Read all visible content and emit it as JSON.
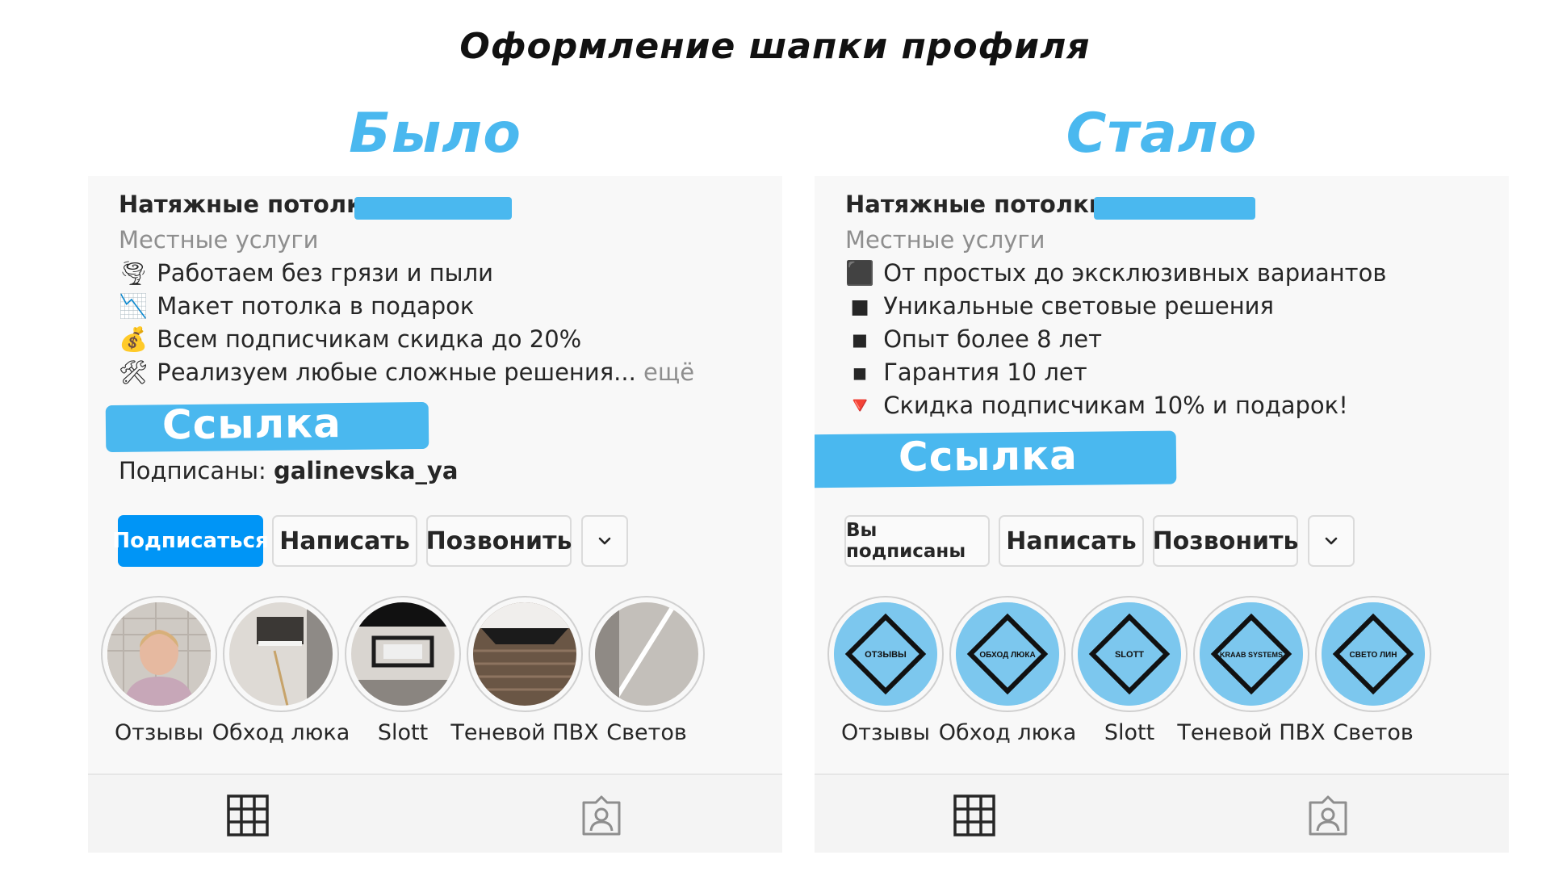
{
  "page": {
    "title": "Оформление шапки профиля"
  },
  "before": {
    "heading": "Было",
    "profile_name": "Натяжные потолки",
    "category": "Местные услуги",
    "bio_lines": [
      {
        "icon": "tornado-icon",
        "glyph": "🌪",
        "text": "Работаем без грязи и пыли"
      },
      {
        "icon": "chart-down-icon",
        "glyph": "📉",
        "text": "Макет потолка в подарок"
      },
      {
        "icon": "money-bag-icon",
        "glyph": "💰",
        "text": "Всем подписчикам скидка до 20%"
      },
      {
        "icon": "tools-icon",
        "glyph": "🛠",
        "text": "Реализуем любые сложные решения..."
      }
    ],
    "more_label": "ещё",
    "link_label": "Ссылка",
    "followed_prefix": "Подписаны:",
    "followed_user": "galinevska_ya",
    "buttons": {
      "follow": "Подписаться",
      "message": "Написать",
      "call": "Позвонить"
    },
    "highlights": [
      "Отзывы",
      "Обход люка",
      "Slott",
      "Теневой ПВХ",
      "Светов"
    ]
  },
  "after": {
    "heading": "Стало",
    "profile_name": "Натяжные потолки",
    "category": "Местные услуги",
    "bio_lines": [
      {
        "icon": "black-large-square-icon",
        "glyph": "⬛",
        "text": "От простых до эксклюзивных вариантов"
      },
      {
        "icon": "black-medium-square-icon",
        "glyph": "◼",
        "text": "Уникальные световые решения"
      },
      {
        "icon": "black-small-square-icon",
        "glyph": "◾",
        "text": "Опыт более 8 лет"
      },
      {
        "icon": "black-tiny-square-icon",
        "glyph": "▪",
        "text": "Гарантия 10 лет"
      },
      {
        "icon": "red-triangle-down-icon",
        "glyph": "🔻",
        "text": "Скидка подписчикам 10% и подарок!"
      }
    ],
    "link_label": "Ссылка",
    "buttons": {
      "following": "Вы подписаны",
      "message": "Написать",
      "call": "Позвонить"
    },
    "highlights": [
      {
        "label": "Отзывы",
        "cover_text": "ОТЗЫВЫ"
      },
      {
        "label": "Обход люка",
        "cover_text": "ОБХОД ЛЮКА"
      },
      {
        "label": "Slott",
        "cover_text": "SLOTT"
      },
      {
        "label": "Теневой ПВХ",
        "cover_text": "KRAAB SYSTEMS"
      },
      {
        "label": "Светов",
        "cover_text": "СВЕТО ЛИН"
      }
    ]
  },
  "colors": {
    "accent": "#4ab8ef",
    "follow_button": "#0095f6",
    "text": "#262626",
    "muted": "#8e8e8e"
  }
}
